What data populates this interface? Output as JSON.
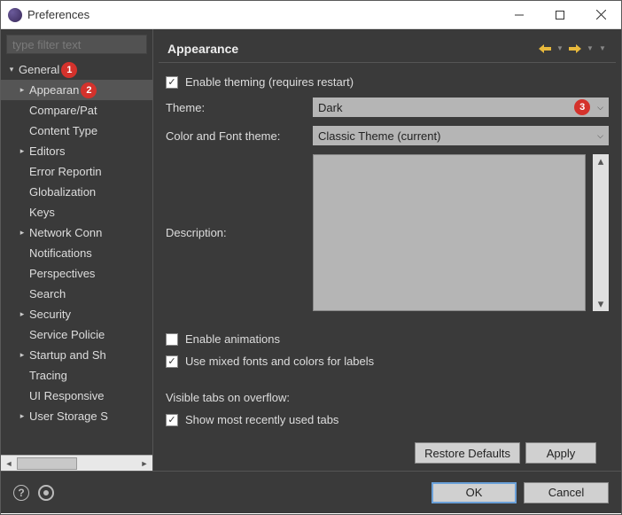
{
  "window": {
    "title": "Preferences"
  },
  "sidebar": {
    "filter_placeholder": "type filter text",
    "general": "General",
    "items": [
      "Appearan",
      "Compare/Pat",
      "Content Type",
      "Editors",
      "Error Reportin",
      "Globalization",
      "Keys",
      "Network Conn",
      "Notifications",
      "Perspectives",
      "Search",
      "Security",
      "Service Policie",
      "Startup and Sh",
      "Tracing",
      "UI Responsive",
      "User Storage S"
    ],
    "expandable": [
      true,
      false,
      false,
      true,
      false,
      false,
      false,
      true,
      false,
      false,
      false,
      true,
      false,
      true,
      false,
      false,
      true
    ]
  },
  "annotations": {
    "one": "1",
    "two": "2",
    "three": "3"
  },
  "page": {
    "title": "Appearance",
    "enable_theming": "Enable theming (requires restart)",
    "theme_label": "Theme:",
    "theme_value": "Dark",
    "cft_label": "Color and Font theme:",
    "cft_value": "Classic Theme (current)",
    "desc_label": "Description:",
    "enable_anim": "Enable animations",
    "mixed_fonts": "Use mixed fonts and colors for labels",
    "visible_tabs": "Visible tabs on overflow:",
    "show_recent": "Show most recently used tabs",
    "restore": "Restore Defaults",
    "apply": "Apply",
    "ok": "OK",
    "cancel": "Cancel"
  }
}
